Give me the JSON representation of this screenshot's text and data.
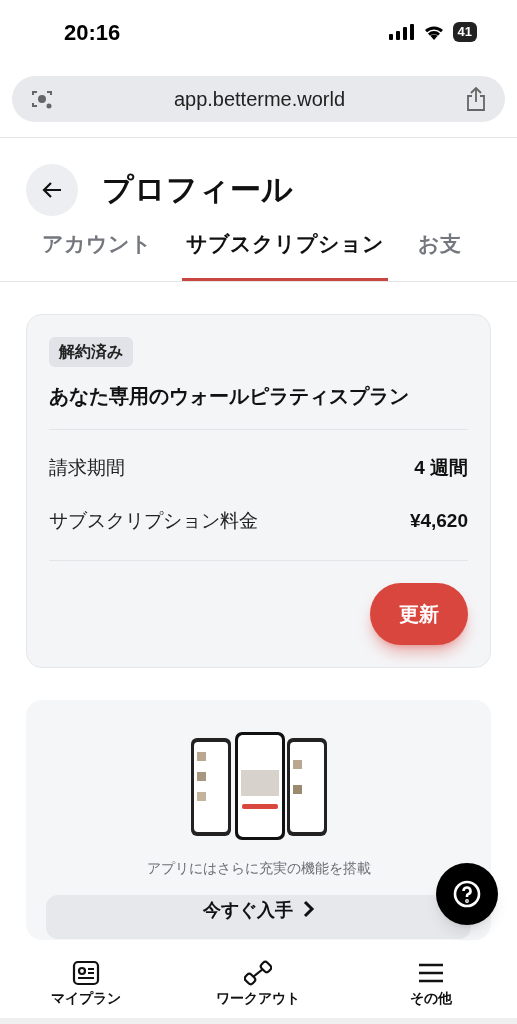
{
  "status_bar": {
    "time": "20:16",
    "battery": "41"
  },
  "browser": {
    "url": "app.betterme.world"
  },
  "header": {
    "title": "プロフィール"
  },
  "tabs": [
    {
      "label": "アカウント",
      "selected": false
    },
    {
      "label": "サブスクリプション",
      "selected": true
    },
    {
      "label": "お支",
      "selected": false
    }
  ],
  "subscription": {
    "status": "解約済み",
    "plan": "あなた専用のウォールピラティスプラン",
    "rows": [
      {
        "label": "請求期間",
        "value": "4 週間"
      },
      {
        "label": "サブスクリプション料金",
        "value": "¥4,620"
      }
    ],
    "button": "更新"
  },
  "promo": {
    "caption": "アプリにはさらに充実の機能を搭載",
    "button": "今すぐ入手"
  },
  "nav": [
    {
      "label": "マイプラン",
      "kind": "plan"
    },
    {
      "label": "ワークアウト",
      "kind": "workout"
    },
    {
      "label": "その他",
      "kind": "more"
    }
  ]
}
